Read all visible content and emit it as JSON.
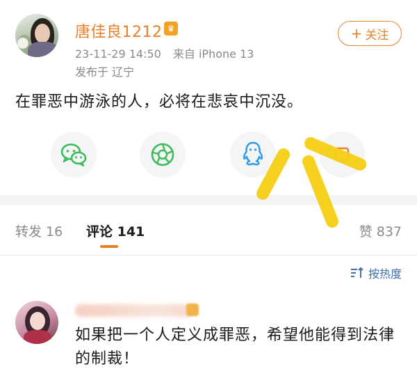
{
  "post": {
    "author_name": "唐佳良1212",
    "time": "23-11-29 14:50",
    "source": "来自 iPhone 13",
    "location": "发布于 辽宁",
    "follow_label": "关注",
    "text": "在罪恶中游泳的人，必将在悲哀中沉没。"
  },
  "share": {
    "icons": [
      "wechat-icon",
      "moments-icon",
      "qq-icon",
      "more-share-icon"
    ]
  },
  "tabs": {
    "repost": "转发 16",
    "comment": "评论 141",
    "like": "赞 837"
  },
  "sort": {
    "label": "按热度"
  },
  "comment": {
    "text": "如果把一个人定义成罪恶，希望他能得到法律的制裁！"
  },
  "colors": {
    "accent": "#e8812b",
    "wechat_green": "#3dbb5a",
    "qq_blue": "#2c9be8",
    "link_blue": "#3f6fb5",
    "annotation_yellow": "#f6cf14"
  }
}
